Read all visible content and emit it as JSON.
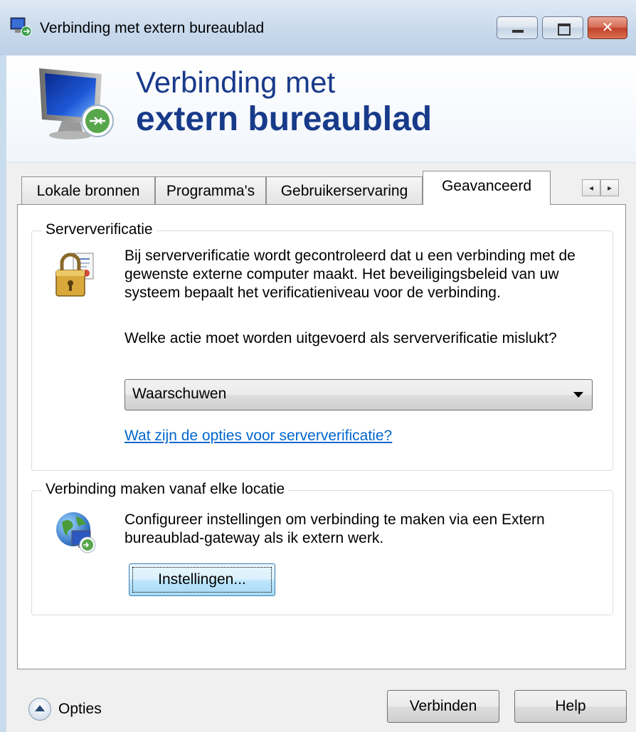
{
  "window": {
    "title": "Verbinding met extern bureaublad",
    "close_glyph": "✕"
  },
  "banner": {
    "line1": "Verbinding met",
    "line2": "extern bureaublad"
  },
  "tabs": [
    {
      "label": "Lokale bronnen",
      "active": false
    },
    {
      "label": "Programma's",
      "active": false
    },
    {
      "label": "Gebruikerservaring",
      "active": false
    },
    {
      "label": "Geavanceerd",
      "active": true
    }
  ],
  "tab_scroll": {
    "left": "◂",
    "right": "▸"
  },
  "server_verification": {
    "legend": "Serververificatie",
    "description": "Bij serververificatie wordt gecontroleerd dat u een verbinding met de gewenste externe computer maakt. Het beveiligingsbeleid van uw systeem bepaalt het verificatieniveau voor de verbinding.",
    "question": "Welke actie moet worden uitgevoerd als serververificatie mislukt?",
    "dropdown_value": "Waarschuwen",
    "help_link": "Wat zijn de opties voor serververificatie?"
  },
  "remote_location": {
    "legend": "Verbinding maken vanaf elke locatie",
    "description": "Configureer instellingen om verbinding te maken via een Extern bureaublad-gateway als ik extern werk.",
    "settings_button": "Instellingen..."
  },
  "footer": {
    "options_label": "Opties",
    "connect_button": "Verbinden",
    "help_button": "Help"
  },
  "colors": {
    "banner_text": "#183a8a",
    "link": "#0066cc",
    "close_button": "#c2422a"
  }
}
